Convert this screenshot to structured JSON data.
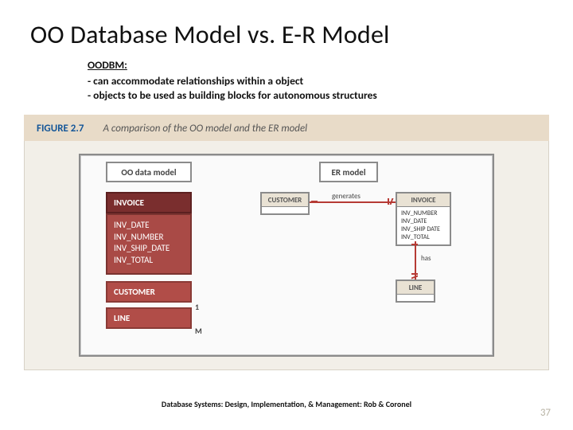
{
  "title": "OO Database Model vs. E-R Model",
  "intro": {
    "subtitle": "OODBM:",
    "b1": "- can accommodate relationships within a object",
    "b2": "- objects to be used as building blocks for autonomous structures"
  },
  "figure": {
    "num": "FIGURE 2.7",
    "caption": "A comparison of the OO model and the ER model"
  },
  "col_heads": {
    "left": "OO data model",
    "right": "ER model"
  },
  "oo": {
    "root": "INVOICE",
    "attrs": [
      "INV_DATE",
      "INV_NUMBER",
      "INV_SHIP_DATE",
      "INV_TOTAL"
    ],
    "child1": "CUSTOMER",
    "child2": "LINE",
    "card1": "1",
    "card2": "M"
  },
  "er": {
    "customer": {
      "name": "CUSTOMER"
    },
    "invoice": {
      "name": "INVOICE",
      "attrs": [
        "INV_NUMBER",
        "INV_DATE",
        "INV_SHIP DATE",
        "INV_TOTAL"
      ]
    },
    "line": {
      "name": "LINE"
    },
    "rel1": "generates",
    "rel2": "has"
  },
  "credit": "Database Systems: Design, Implementation, & Management: Rob & Coronel",
  "page": "37"
}
